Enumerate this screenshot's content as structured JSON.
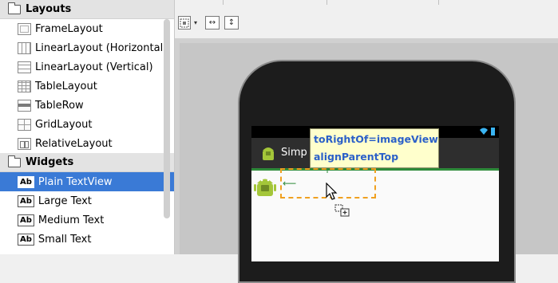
{
  "palette": {
    "sections": [
      {
        "label": "Layouts",
        "items": [
          {
            "label": "FrameLayout",
            "icon": "frame-layout-icon"
          },
          {
            "label": "LinearLayout (Horizontal)",
            "icon": "linear-layout-horizontal-icon"
          },
          {
            "label": "LinearLayout (Vertical)",
            "icon": "linear-layout-vertical-icon"
          },
          {
            "label": "TableLayout",
            "icon": "table-layout-icon"
          },
          {
            "label": "TableRow",
            "icon": "table-row-icon"
          },
          {
            "label": "GridLayout",
            "icon": "grid-layout-icon"
          },
          {
            "label": "RelativeLayout",
            "icon": "relative-layout-icon"
          }
        ]
      },
      {
        "label": "Widgets",
        "items": [
          {
            "label": "Plain TextView",
            "badge": "Ab",
            "selected": true
          },
          {
            "label": "Large Text",
            "badge": "Ab"
          },
          {
            "label": "Medium Text",
            "badge": "Ab"
          },
          {
            "label": "Small Text",
            "badge": "Ab"
          }
        ]
      }
    ]
  },
  "toolbar": {
    "zoom_icon": "zoom-to-fit-icon",
    "dropdown_glyph": "▾",
    "width_glyph": "↔",
    "height_glyph": "↕"
  },
  "device": {
    "app_title": "Simp",
    "status_icons": [
      "wifi-icon",
      "battery-icon"
    ]
  },
  "tooltip": {
    "line1": "toRightOf=imageView",
    "line2": "alignParentTop"
  },
  "colors": {
    "selection": "#3a7ad6",
    "guide_green": "#2e8b3a",
    "drop_orange": "#f0a020",
    "tooltip_bg": "#ffffcc",
    "tooltip_text": "#2b60c8"
  }
}
